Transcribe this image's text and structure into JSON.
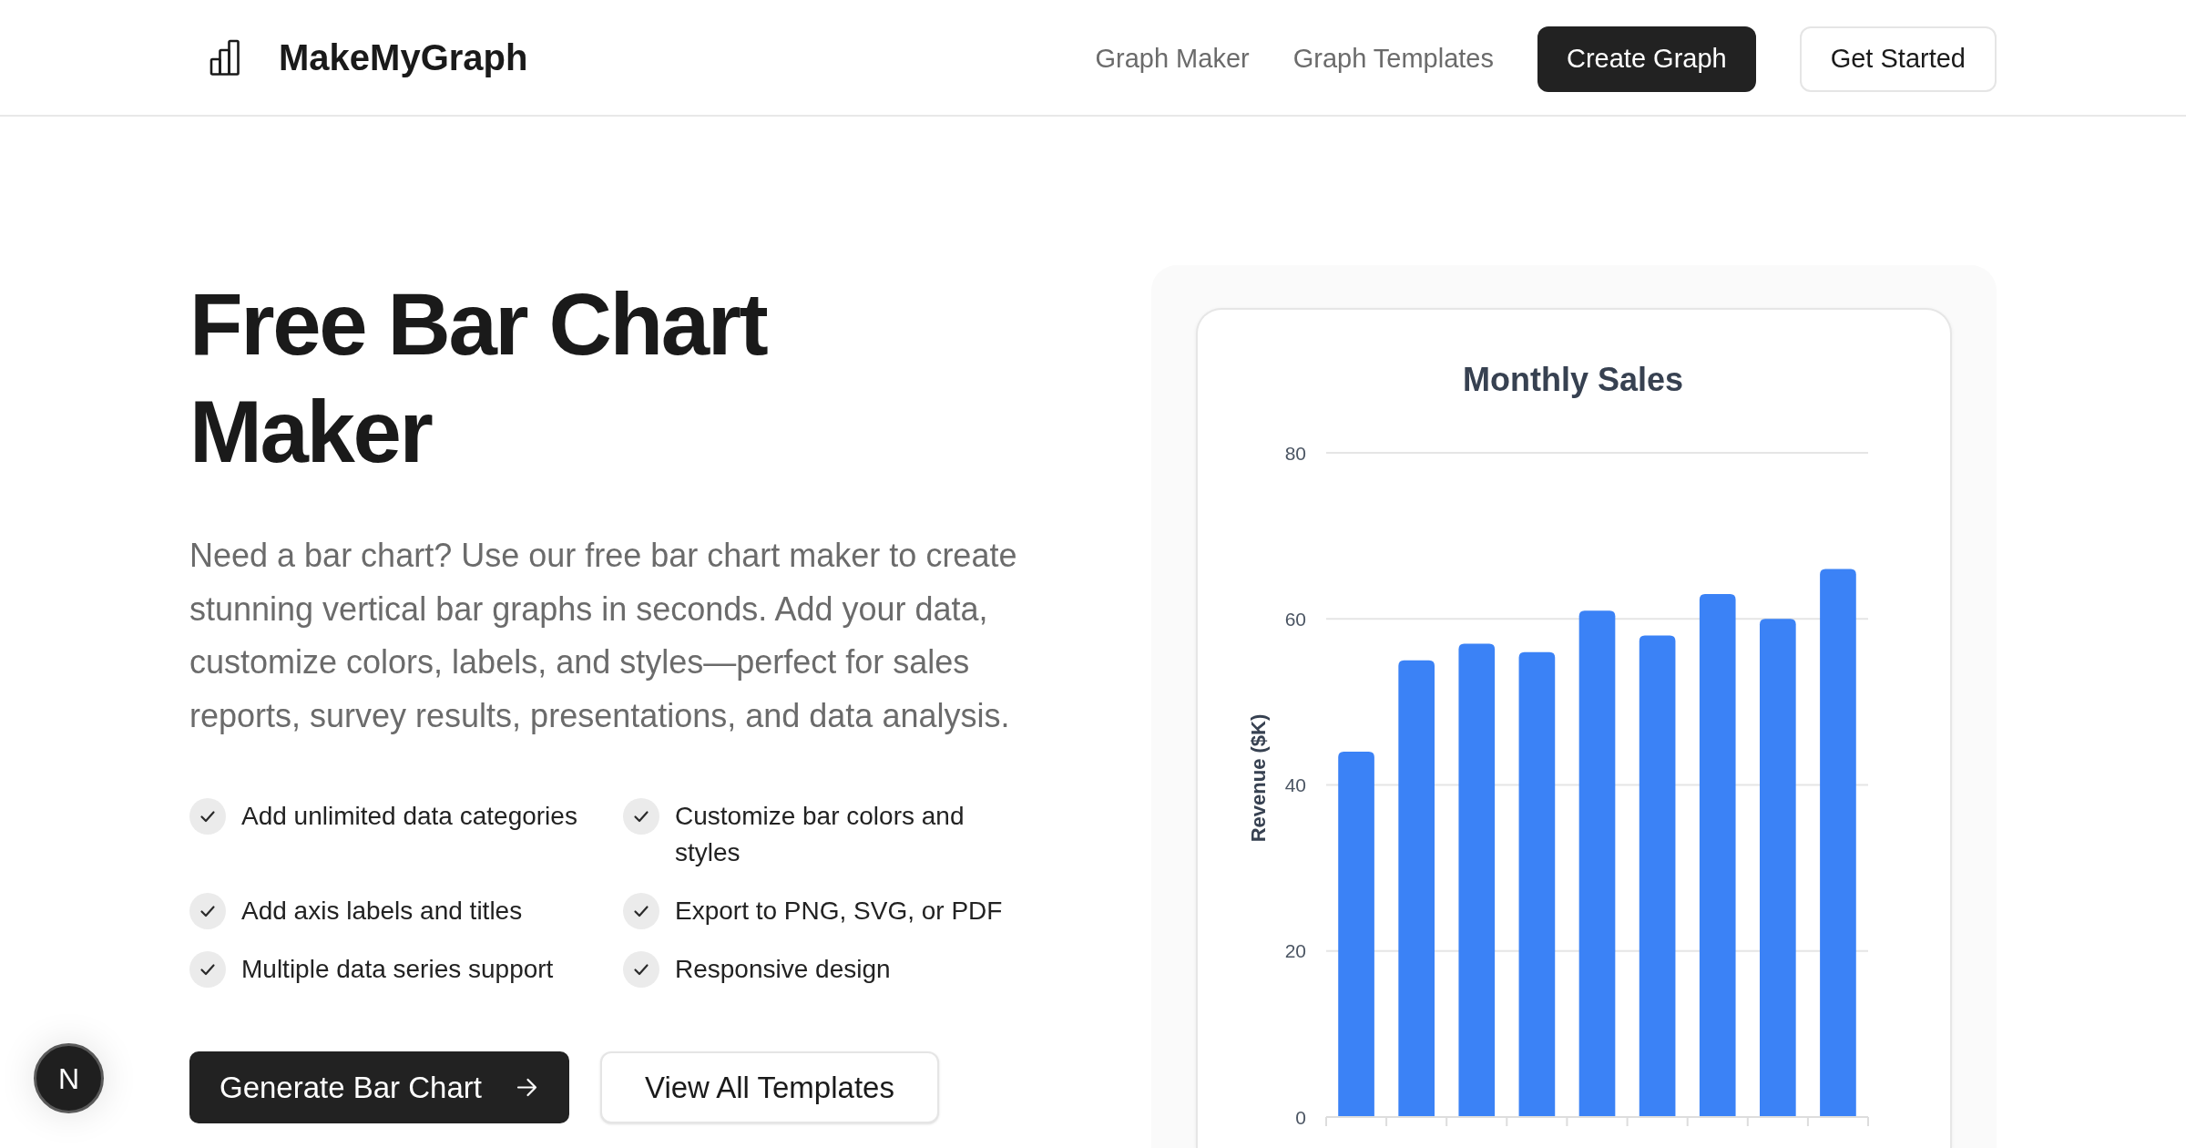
{
  "header": {
    "logo": "MakeMyGraph",
    "nav_links": [
      "Graph Maker",
      "Graph Templates"
    ],
    "buttons": [
      {
        "label": "Create Graph",
        "kind": "primary"
      },
      {
        "label": "Get Started",
        "kind": "secondary"
      }
    ]
  },
  "hero": {
    "title": "Free Bar Chart Maker",
    "description": "Need a bar chart? Use our free bar chart maker to create stunning vertical bar graphs in seconds. Add your data, customize colors, labels, and styles—perfect for sales reports, survey results, presentations, and data analysis.",
    "features": [
      "Add unlimited data categories",
      "Customize bar colors and styles",
      "Add axis labels and titles",
      "Export to PNG, SVG, or PDF",
      "Multiple data series support",
      "Responsive design"
    ],
    "buttons": [
      {
        "label": "Generate Bar Chart",
        "kind": "primary"
      },
      {
        "label": "View All Templates",
        "kind": "secondary"
      }
    ]
  },
  "preview": {
    "chart_data": {
      "type": "bar",
      "title": "Monthly Sales",
      "ylabel": "Revenue ($K)",
      "values": [
        44,
        55,
        57,
        56,
        61,
        58,
        63,
        60,
        66
      ],
      "ylim": [
        0,
        80
      ],
      "yticks": [
        0,
        20,
        40,
        60,
        80
      ],
      "grid": true
    }
  },
  "dev_badge": {
    "label": "N"
  }
}
